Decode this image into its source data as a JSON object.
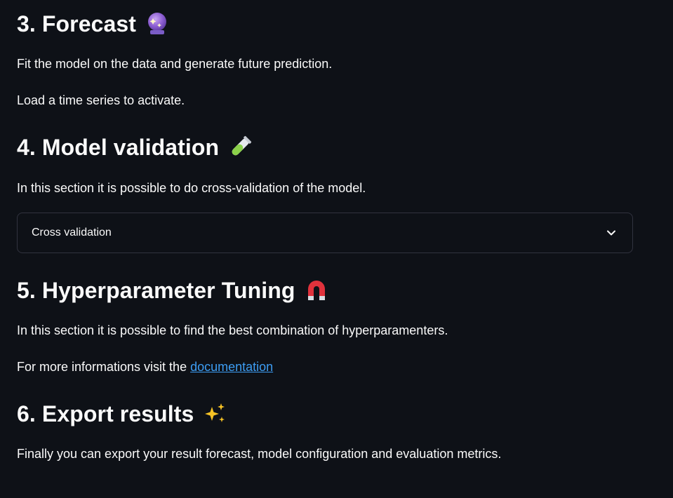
{
  "sections": {
    "forecast": {
      "title": "3. Forecast",
      "icon": "crystal-ball-icon",
      "description": "Fit the model on the data and generate future prediction.",
      "status": "Load a time series to activate."
    },
    "validation": {
      "title": "4. Model validation",
      "icon": "test-tube-icon",
      "description": "In this section it is possible to do cross-validation of the model.",
      "expander_label": "Cross validation",
      "expander_icon": "chevron-down-icon"
    },
    "tuning": {
      "title": "5. Hyperparameter Tuning",
      "icon": "magnet-icon",
      "description": "In this section it is possible to find the best combination of hyperparamenters.",
      "more_prefix": "For more informations visit the ",
      "more_link": "documentation"
    },
    "export": {
      "title": "6. Export results",
      "icon": "sparkles-icon",
      "description": "Finally you can export your result forecast, model configuration and evaluation metrics."
    }
  },
  "colors": {
    "background": "#0e1117",
    "text": "#fafafa",
    "link": "#3d9df3",
    "border": "#31333f"
  }
}
